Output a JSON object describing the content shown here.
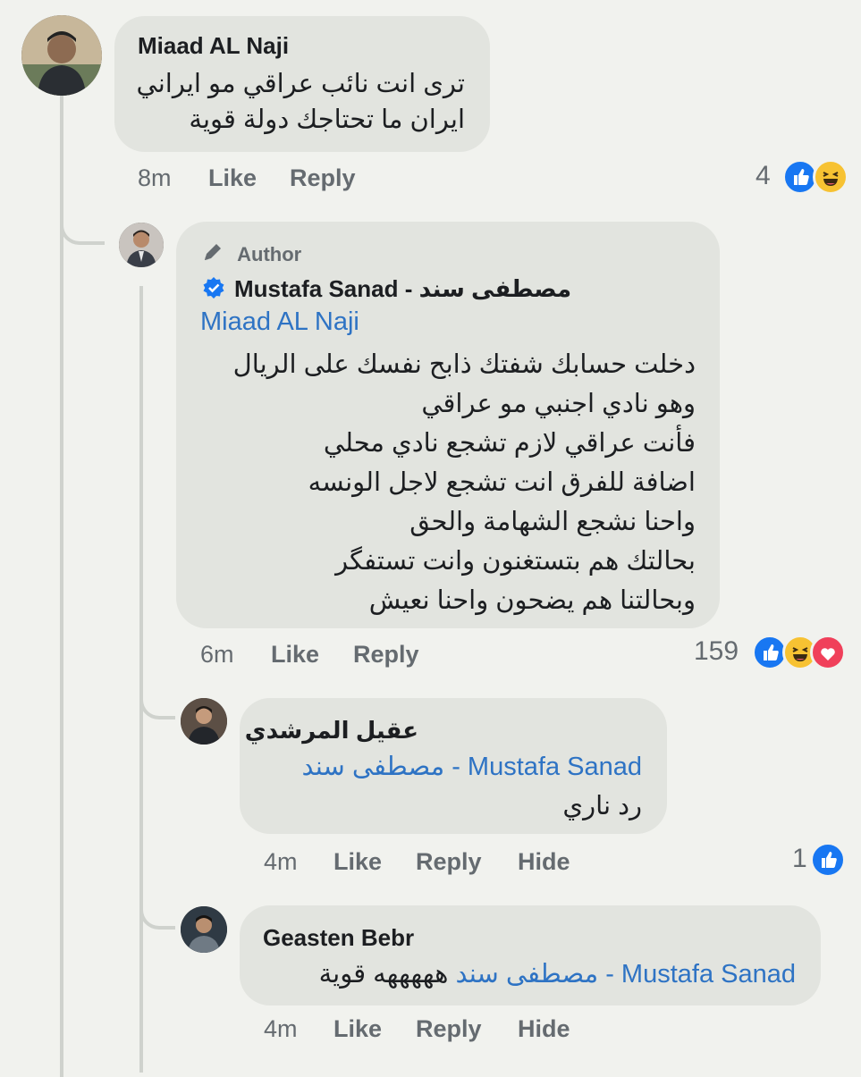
{
  "comments": [
    {
      "name": "Miaad AL Naji",
      "lines": [
        "ترى انت نائب عراقي مو ايراني",
        "ايران ما تحتاجك دولة قوية"
      ],
      "time": "8m",
      "like": "Like",
      "reply": "Reply",
      "reactions": "4"
    },
    {
      "badge": "Author",
      "name": "Mustafa Sanad - مصطفى سند",
      "mention": "Miaad AL Naji",
      "lines": [
        "دخلت حسابك شفتك ذابح نفسك على الريال",
        "وهو نادي اجنبي مو عراقي",
        "فأنت عراقي لازم تشجع نادي محلي",
        "اضافة للفرق انت تشجع لاجل الونسه",
        "واحنا نشجع الشهامة والحق",
        "بحالتك هم بتستغنون وانت تستفگر",
        "وبحالتنا هم يضحون واحنا نعيش"
      ],
      "time": "6m",
      "like": "Like",
      "reply": "Reply",
      "reactions": "159"
    },
    {
      "name": "عقيل المرشدي",
      "mention": "Mustafa Sanad - مصطفى سند",
      "lines": [
        "رد ناري"
      ],
      "time": "4m",
      "like": "Like",
      "reply": "Reply",
      "hide": "Hide",
      "reactions": "1"
    },
    {
      "name": "Geasten Bebr",
      "mention": "Mustafa Sanad - مصطفى سند",
      "text": "هههههه قوية",
      "time": "4m",
      "like": "Like",
      "reply": "Reply",
      "hide": "Hide"
    }
  ],
  "colors": {
    "link": "#2e73c4",
    "like": "#1877f2",
    "haha": "#f7c232",
    "love": "#f0405a",
    "bubble": "#e2e4df"
  },
  "icons": [
    "pencil-icon",
    "verified-badge-icon",
    "like-reaction-icon",
    "haha-reaction-icon",
    "love-reaction-icon"
  ]
}
